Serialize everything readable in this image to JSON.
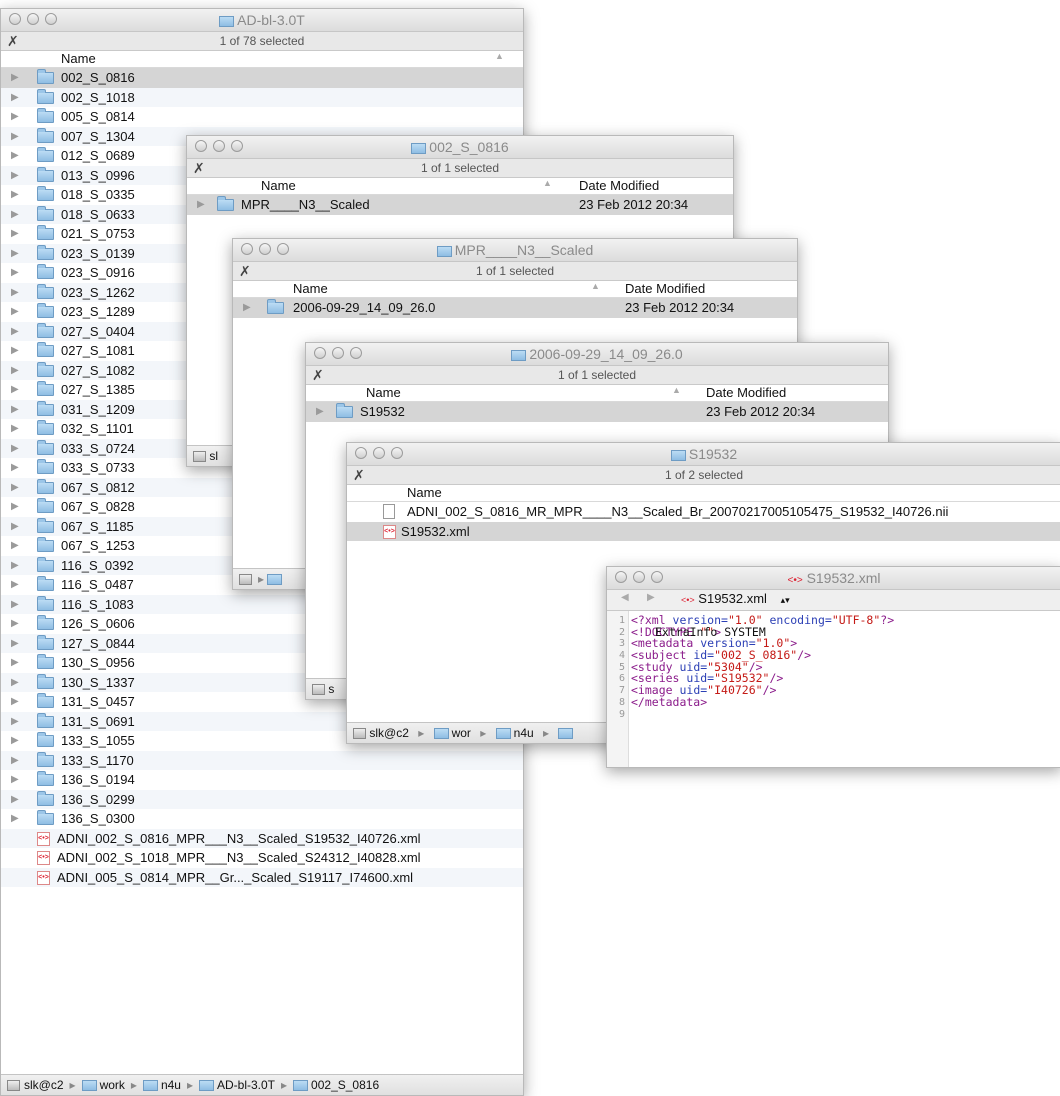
{
  "win1": {
    "title": "AD-bl-3.0T",
    "status": "1 of 78 selected",
    "col_name": "Name",
    "folders": [
      "002_S_0816",
      "002_S_1018",
      "005_S_0814",
      "007_S_1304",
      "012_S_0689",
      "013_S_0996",
      "018_S_0335",
      "018_S_0633",
      "021_S_0753",
      "023_S_0139",
      "023_S_0916",
      "023_S_1262",
      "023_S_1289",
      "027_S_0404",
      "027_S_1081",
      "027_S_1082",
      "027_S_1385",
      "031_S_1209",
      "032_S_1101",
      "033_S_0724",
      "033_S_0733",
      "067_S_0812",
      "067_S_0828",
      "067_S_1185",
      "067_S_1253",
      "116_S_0392",
      "116_S_0487",
      "116_S_1083",
      "126_S_0606",
      "127_S_0844",
      "130_S_0956",
      "130_S_1337",
      "131_S_0457",
      "131_S_0691",
      "133_S_1055",
      "133_S_1170",
      "136_S_0194",
      "136_S_0299",
      "136_S_0300"
    ],
    "files": [
      "ADNI_002_S_0816_MPR___N3__Scaled_S19532_I40726.xml",
      "ADNI_002_S_1018_MPR___N3__Scaled_S24312_I40828.xml",
      "ADNI_005_S_0814_MPR__Gr..._Scaled_S19117_I74600.xml"
    ],
    "path": [
      "slk@c2",
      "work",
      "n4u",
      "AD-bl-3.0T",
      "002_S_0816"
    ]
  },
  "win2": {
    "title": "002_S_0816",
    "status": "1 of 1 selected",
    "col_name": "Name",
    "col_date": "Date Modified",
    "row": {
      "name": "MPR____N3__Scaled",
      "date": "23 Feb 2012 20:34"
    },
    "path_start": "sl"
  },
  "win3": {
    "title": "MPR____N3__Scaled",
    "status": "1 of 1 selected",
    "col_name": "Name",
    "col_date": "Date Modified",
    "row": {
      "name": "2006-09-29_14_09_26.0",
      "date": "23 Feb 2012 20:34"
    }
  },
  "win4": {
    "title": "2006-09-29_14_09_26.0",
    "status": "1 of 1 selected",
    "col_name": "Name",
    "col_date": "Date Modified",
    "row": {
      "name": "S19532",
      "date": "23 Feb 2012 20:34"
    },
    "path_start": "s"
  },
  "win5": {
    "title": "S19532",
    "status": "1 of 2 selected",
    "col_name": "Name",
    "files": [
      "ADNI_002_S_0816_MR_MPR____N3__Scaled_Br_20070217005105475_S19532_I40726.nii",
      "S19532.xml"
    ],
    "path": [
      "slk@c2",
      "wor",
      "n4u"
    ]
  },
  "xml_win": {
    "title": "S19532.xml",
    "file_popup": "S19532.xml",
    "lines": [
      [
        [
          "kw",
          "<?xml "
        ],
        [
          "attr",
          "version="
        ],
        [
          "str",
          "\"1.0\""
        ],
        [
          "attr",
          " encoding="
        ],
        [
          "str",
          "\"UTF-8\""
        ],
        [
          "kw",
          "?>"
        ]
      ],
      [
        [
          "kw",
          "<!DOCTYPE "
        ],
        [
          "txt",
          "ExtraInfo SYSTEM "
        ],
        [
          "str",
          "\"\""
        ],
        [
          "kw",
          ">"
        ]
      ],
      [
        [
          "tag",
          "<metadata "
        ],
        [
          "attr",
          "version="
        ],
        [
          "str",
          "\"1.0\""
        ],
        [
          "tag",
          ">"
        ]
      ],
      [
        [
          "txt",
          "  "
        ],
        [
          "tag",
          "<subject "
        ],
        [
          "attr",
          "id="
        ],
        [
          "str",
          "\"002_S_0816\""
        ],
        [
          "tag",
          "/>"
        ]
      ],
      [
        [
          "txt",
          "  "
        ],
        [
          "tag",
          "<study "
        ],
        [
          "attr",
          "uid="
        ],
        [
          "str",
          "\"5304\""
        ],
        [
          "tag",
          "/>"
        ]
      ],
      [
        [
          "txt",
          "  "
        ],
        [
          "tag",
          "<series "
        ],
        [
          "attr",
          "uid="
        ],
        [
          "str",
          "\"S19532\""
        ],
        [
          "tag",
          "/>"
        ]
      ],
      [
        [
          "txt",
          "  "
        ],
        [
          "tag",
          "<image "
        ],
        [
          "attr",
          "uid="
        ],
        [
          "str",
          "\"I40726\""
        ],
        [
          "tag",
          "/>"
        ]
      ],
      [
        [
          "tag",
          "</metadata>"
        ]
      ],
      []
    ]
  }
}
